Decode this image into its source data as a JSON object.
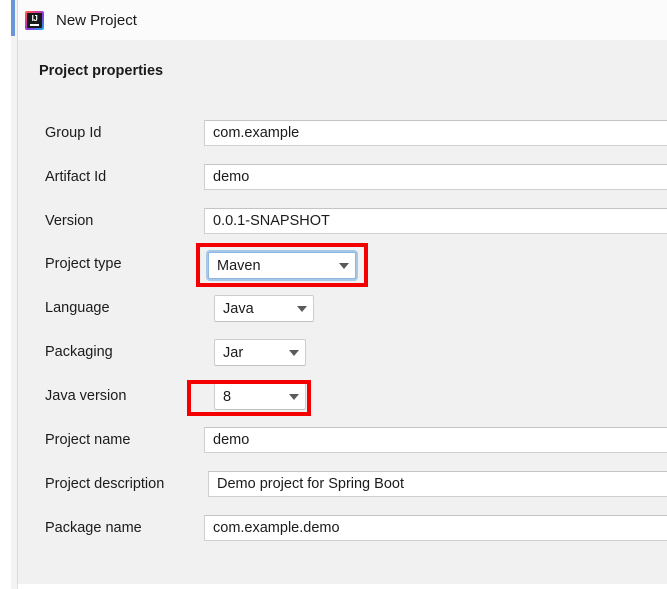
{
  "window": {
    "title": "New Project",
    "icon": "intellij-idea-icon",
    "icon_letters": "IJ"
  },
  "section": {
    "title": "Project properties"
  },
  "form": {
    "rows": [
      {
        "label": "Group Id",
        "type": "text",
        "value": "com.example",
        "name": "group-id"
      },
      {
        "label": "Artifact Id",
        "type": "text",
        "value": "demo",
        "name": "artifact-id"
      },
      {
        "label": "Version",
        "type": "text",
        "value": "0.0.1-SNAPSHOT",
        "name": "version"
      },
      {
        "label": "Project type",
        "type": "combo",
        "value": "Maven",
        "name": "project-type"
      },
      {
        "label": "Language",
        "type": "combo",
        "value": "Java",
        "name": "language"
      },
      {
        "label": "Packaging",
        "type": "combo",
        "value": "Jar",
        "name": "packaging"
      },
      {
        "label": "Java version",
        "type": "combo",
        "value": "8",
        "name": "java-version"
      },
      {
        "label": "Project name",
        "type": "text",
        "value": "demo",
        "name": "project-name"
      },
      {
        "label": "Project description",
        "type": "text",
        "value": "Demo project for Spring Boot",
        "name": "project-description"
      },
      {
        "label": "Package name",
        "type": "text",
        "value": "com.example.demo",
        "name": "package-name"
      }
    ]
  },
  "annotations": {
    "color": "#f40000",
    "boxes": [
      {
        "target": "project-type",
        "label": ""
      },
      {
        "target": "java-version",
        "label": ""
      }
    ]
  },
  "colors": {
    "panel_background": "#f1f1f1",
    "titlebar_background": "#fbfbfb",
    "input_background": "#ffffff",
    "input_border": "#cfcfcf",
    "text": "#1b1b1b",
    "focus_ring": "#a8c8ea",
    "highlight": "#f40000",
    "window_accent": "#6a95d8"
  }
}
